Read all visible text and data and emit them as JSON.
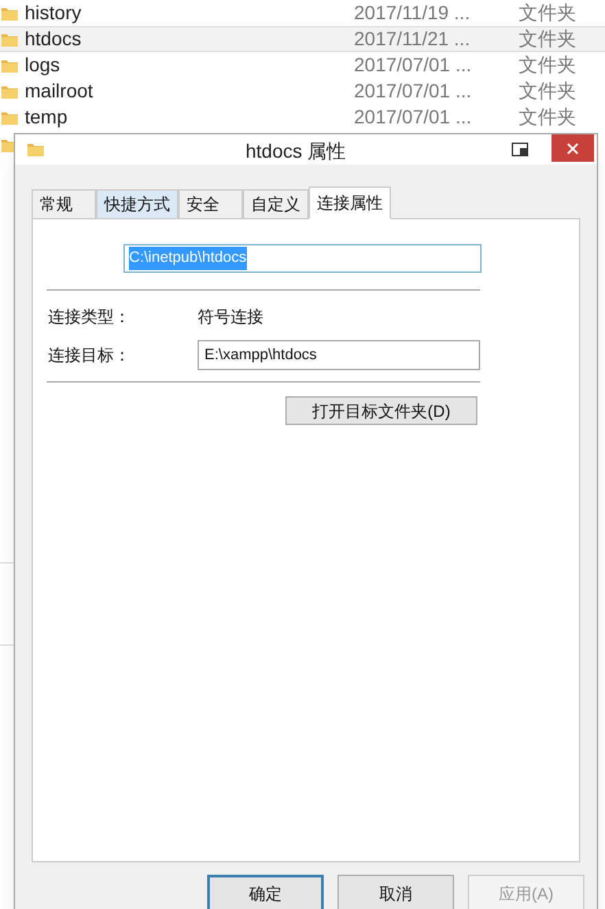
{
  "explorer": {
    "rows": [
      {
        "name": "history",
        "date": "2017/11/19 ...",
        "type": "文件夹",
        "selected": false
      },
      {
        "name": "htdocs",
        "date": "2017/11/21 ...",
        "type": "文件夹",
        "selected": true
      },
      {
        "name": "logs",
        "date": "2017/07/01 ...",
        "type": "文件夹",
        "selected": false
      },
      {
        "name": "mailroot",
        "date": "2017/07/01 ...",
        "type": "文件夹",
        "selected": false
      },
      {
        "name": "temp",
        "date": "2017/07/01 ...",
        "type": "文件夹",
        "selected": false
      }
    ]
  },
  "dialog": {
    "title": "htdocs 属性",
    "tabs": [
      {
        "label": "常规",
        "selected": false,
        "hovered": false
      },
      {
        "label": "快捷方式",
        "selected": false,
        "hovered": true
      },
      {
        "label": "安全",
        "selected": false,
        "hovered": false
      },
      {
        "label": "自定义",
        "selected": false,
        "hovered": false
      },
      {
        "label": "连接属性",
        "selected": true,
        "hovered": false
      }
    ],
    "path_field": {
      "value": "C:\\inetpub\\htdocs",
      "text_selected": true
    },
    "fields": [
      {
        "kind": "text",
        "label": "连接类型：",
        "value": "符号连接"
      },
      {
        "kind": "input",
        "label": "连接目标：",
        "value": "E:\\xampp\\htdocs"
      }
    ],
    "open_button": "打开目标文件夹(D)",
    "buttons": [
      {
        "label": "确定",
        "default": true,
        "disabled": false
      },
      {
        "label": "取消",
        "default": false,
        "disabled": false
      },
      {
        "label": "应用(A)",
        "default": false,
        "disabled": true
      }
    ]
  }
}
